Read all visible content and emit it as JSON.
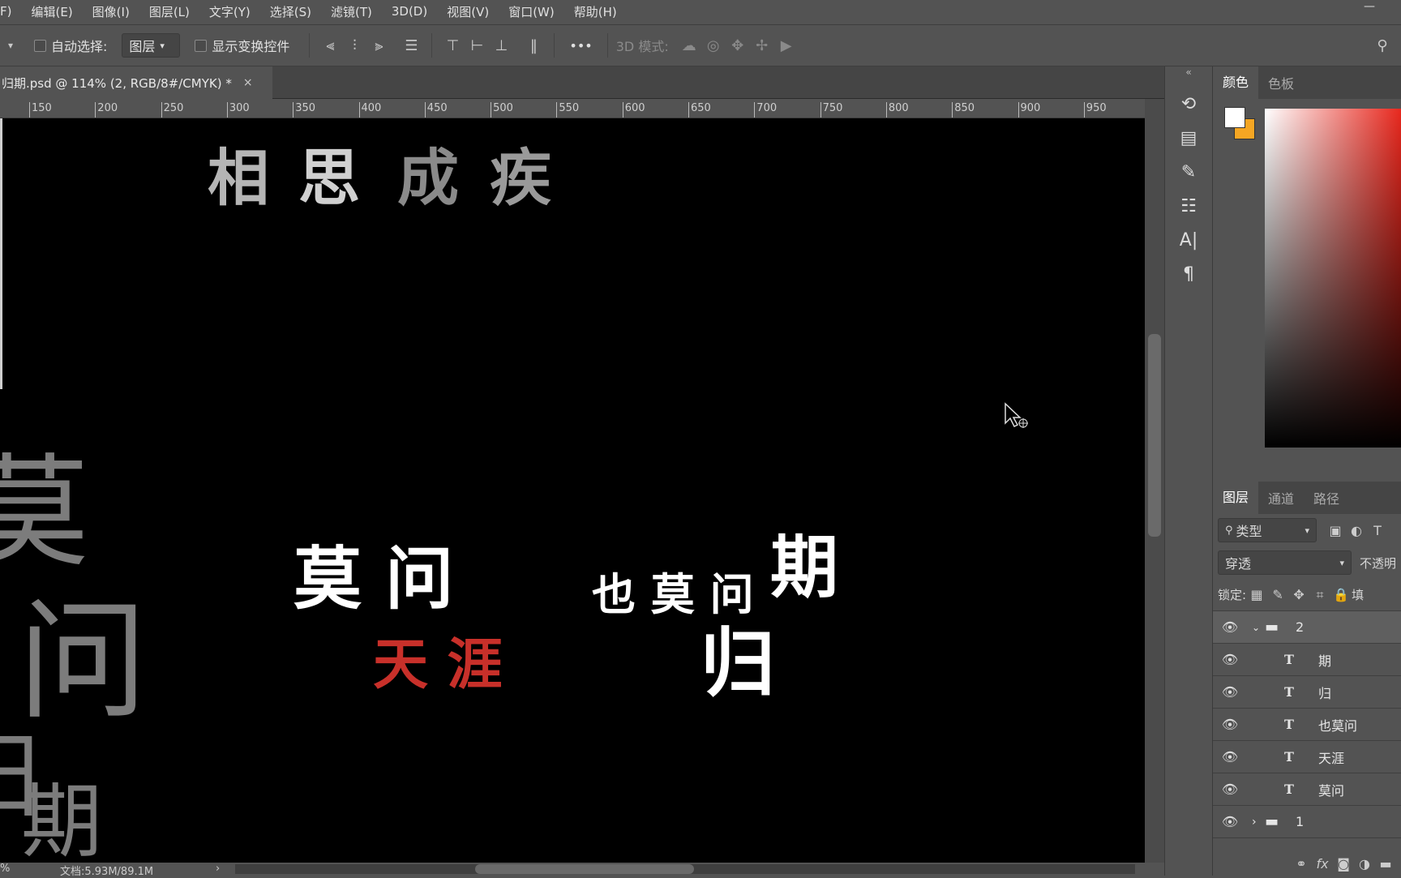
{
  "menu": [
    "F)",
    "编辑(E)",
    "图像(I)",
    "图层(L)",
    "文字(Y)",
    "选择(S)",
    "滤镜(T)",
    "3D(D)",
    "视图(V)",
    "窗口(W)",
    "帮助(H)"
  ],
  "options": {
    "auto_select_label": "自动选择:",
    "auto_select_value": "图层",
    "show_transform_label": "显示变换控件",
    "more_label": "•••",
    "mode_3d_label": "3D 模式:"
  },
  "document": {
    "tab_title": "归期.psd @ 114% (2, RGB/8#/CMYK) *",
    "close_glyph": "×"
  },
  "ruler": {
    "ticks": [
      "150",
      "200",
      "250",
      "300",
      "350",
      "400",
      "450",
      "500",
      "550",
      "600",
      "650",
      "700",
      "750",
      "800",
      "850",
      "900",
      "950"
    ]
  },
  "canvas": {
    "line1": [
      "相",
      "思",
      "成",
      "疾"
    ],
    "phrase_left": "莫 问",
    "phrase_red": "天 涯",
    "phrase_mid": "也 莫 问",
    "qi": "期",
    "gui": "归",
    "side_large": [
      "莫",
      "问",
      "归",
      "期"
    ]
  },
  "status": {
    "zoom": "%",
    "doc_info": "文档:5.93M/89.1M"
  },
  "color_panel": {
    "tabs": [
      "颜色",
      "色板"
    ]
  },
  "layers_panel": {
    "tabs": [
      "图层",
      "通道",
      "路径"
    ],
    "filter_label": "类型",
    "blend_mode": "穿透",
    "opacity_label": "不透明",
    "lock_label": "锁定:",
    "fill_label": "填",
    "layers": [
      {
        "kind": "folder",
        "name": "2",
        "expanded": true,
        "indent": 0
      },
      {
        "kind": "text",
        "name": "期"
      },
      {
        "kind": "text",
        "name": "归"
      },
      {
        "kind": "text",
        "name": "也莫问"
      },
      {
        "kind": "text",
        "name": "天涯"
      },
      {
        "kind": "text",
        "name": "莫问"
      },
      {
        "kind": "folder",
        "name": "1",
        "expanded": false,
        "indent": 0
      }
    ],
    "bottom_fx": "fx"
  },
  "colors": {
    "accent_red": "#c8302a",
    "fg_swatch": "#ffffff",
    "bg_swatch": "#f5a623"
  }
}
